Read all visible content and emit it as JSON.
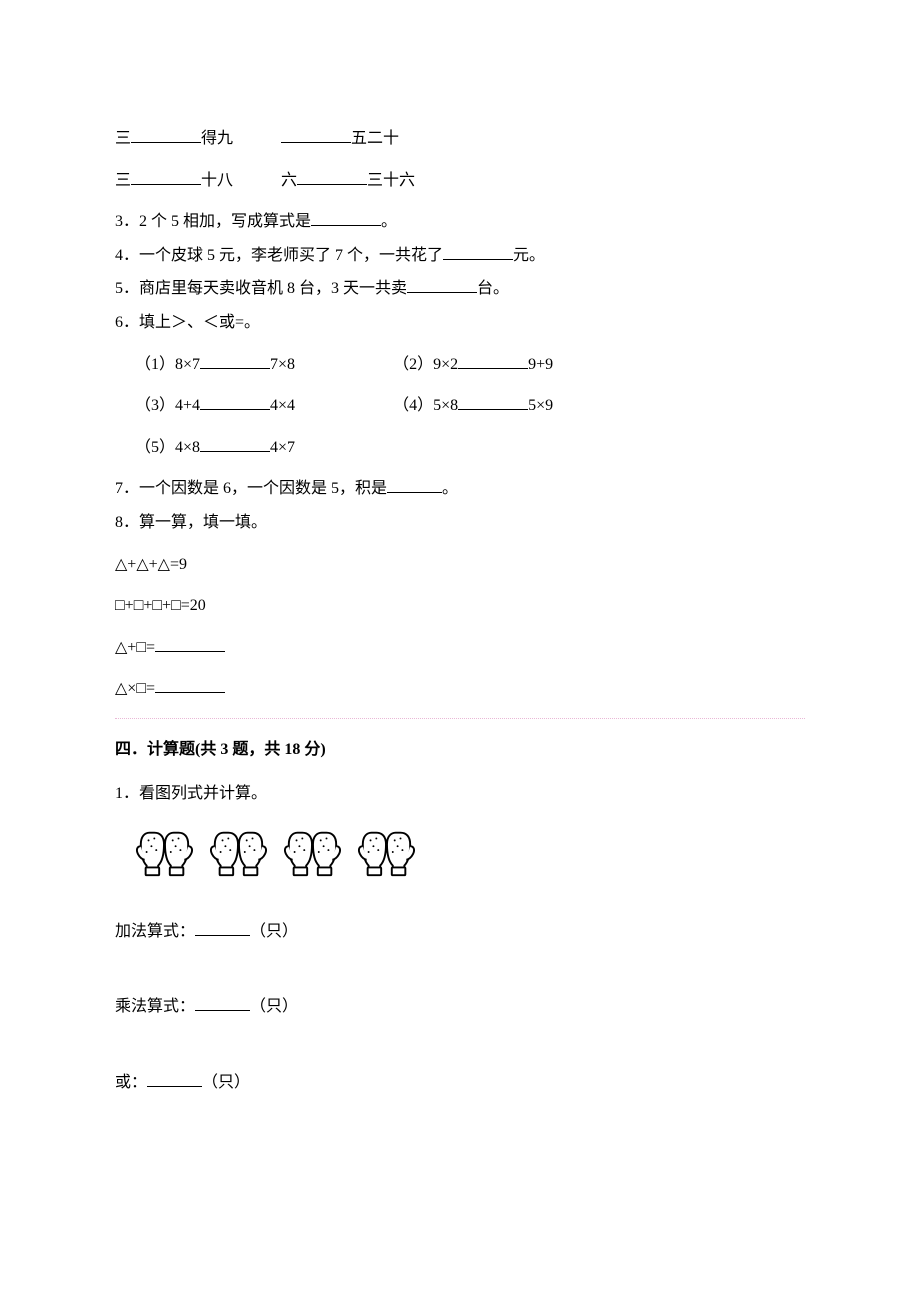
{
  "fill_rhyme": {
    "r1a_pre": "三",
    "r1a_post": "得九",
    "r1b_post": "五二十",
    "r2a_pre": "三",
    "r2a_post": "十八",
    "r2b_pre": "六",
    "r2b_post": "三十六"
  },
  "q3": {
    "text_a": "3．2 个 5 相加，写成算式是",
    "text_b": "。"
  },
  "q4": {
    "text_a": "4．一个皮球 5 元，李老师买了 7 个，一共花了",
    "text_b": "元。"
  },
  "q5": {
    "text_a": "5．商店里每天卖收音机 8 台，3 天一共卖",
    "text_b": "台。"
  },
  "q6": {
    "title": "6．填上＞、＜或=。",
    "i1a": "（1）8×7",
    "i1b": "7×8",
    "i2a": "（2）9×2",
    "i2b": "9+9",
    "i3a": "（3）4+4",
    "i3b": "4×4",
    "i4a": "（4）5×8",
    "i4b": "5×9",
    "i5a": "（5）4×8",
    "i5b": "4×7"
  },
  "q7": {
    "text_a": "7．一个因数是 6，一个因数是 5，积是",
    "text_b": "。"
  },
  "q8": {
    "title": "8．算一算，填一填。",
    "line1": "△+△+△=9",
    "line2": "□+□+□+□=20",
    "line3_pre": "△+□=",
    "line4_pre": "△×□="
  },
  "section4": {
    "heading": "四．计算题(共 3 题，共 18 分)",
    "q1_title": "1．看图列式并计算。",
    "add_label_pre": "加法算式：",
    "add_label_post": "（只）",
    "mul_label_pre": "乘法算式：",
    "mul_label_post": "（只）",
    "or_label_pre": "或：",
    "or_label_post": "（只）"
  }
}
